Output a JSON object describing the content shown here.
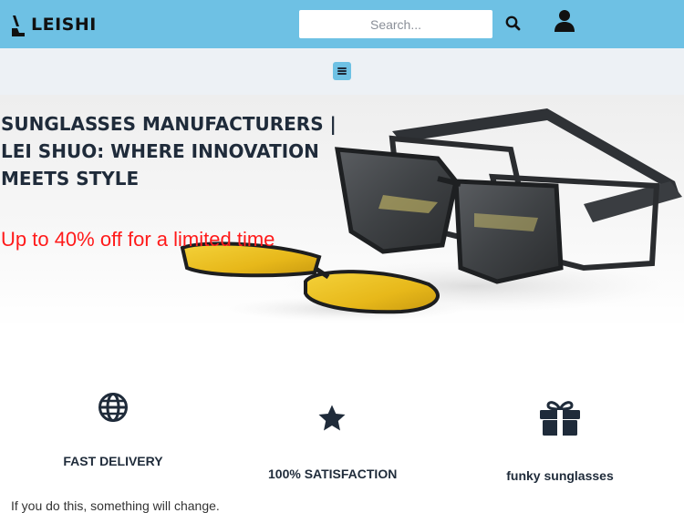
{
  "header": {
    "logo_text": "LEISHI",
    "search": {
      "placeholder": "Search...",
      "value": ""
    },
    "icons": {
      "logo": "leishi-logo-mark",
      "search": "search-icon",
      "account": "user-icon"
    }
  },
  "nav": {
    "menu_icon": "hamburger-menu-icon"
  },
  "hero": {
    "title": "SUNGLASSES MANUFACTURERS | LEI SHUO: WHERE INNOVATION MEETS STYLE",
    "promo": "Up to 40% off for a limited time",
    "image": "clip-on-sunglasses-photo"
  },
  "features": [
    {
      "icon": "globe-icon",
      "label": "FAST DELIVERY"
    },
    {
      "icon": "star-icon",
      "label": "100% SATISFACTION"
    },
    {
      "icon": "gift-icon",
      "label": "funky sunglasses"
    }
  ],
  "footer_note": "If you do this, something will change.",
  "colors": {
    "header_bg": "#6ec1e4",
    "nav_bg": "#edf1f5",
    "heading": "#1f2b3a",
    "promo": "#ff1a1a"
  }
}
